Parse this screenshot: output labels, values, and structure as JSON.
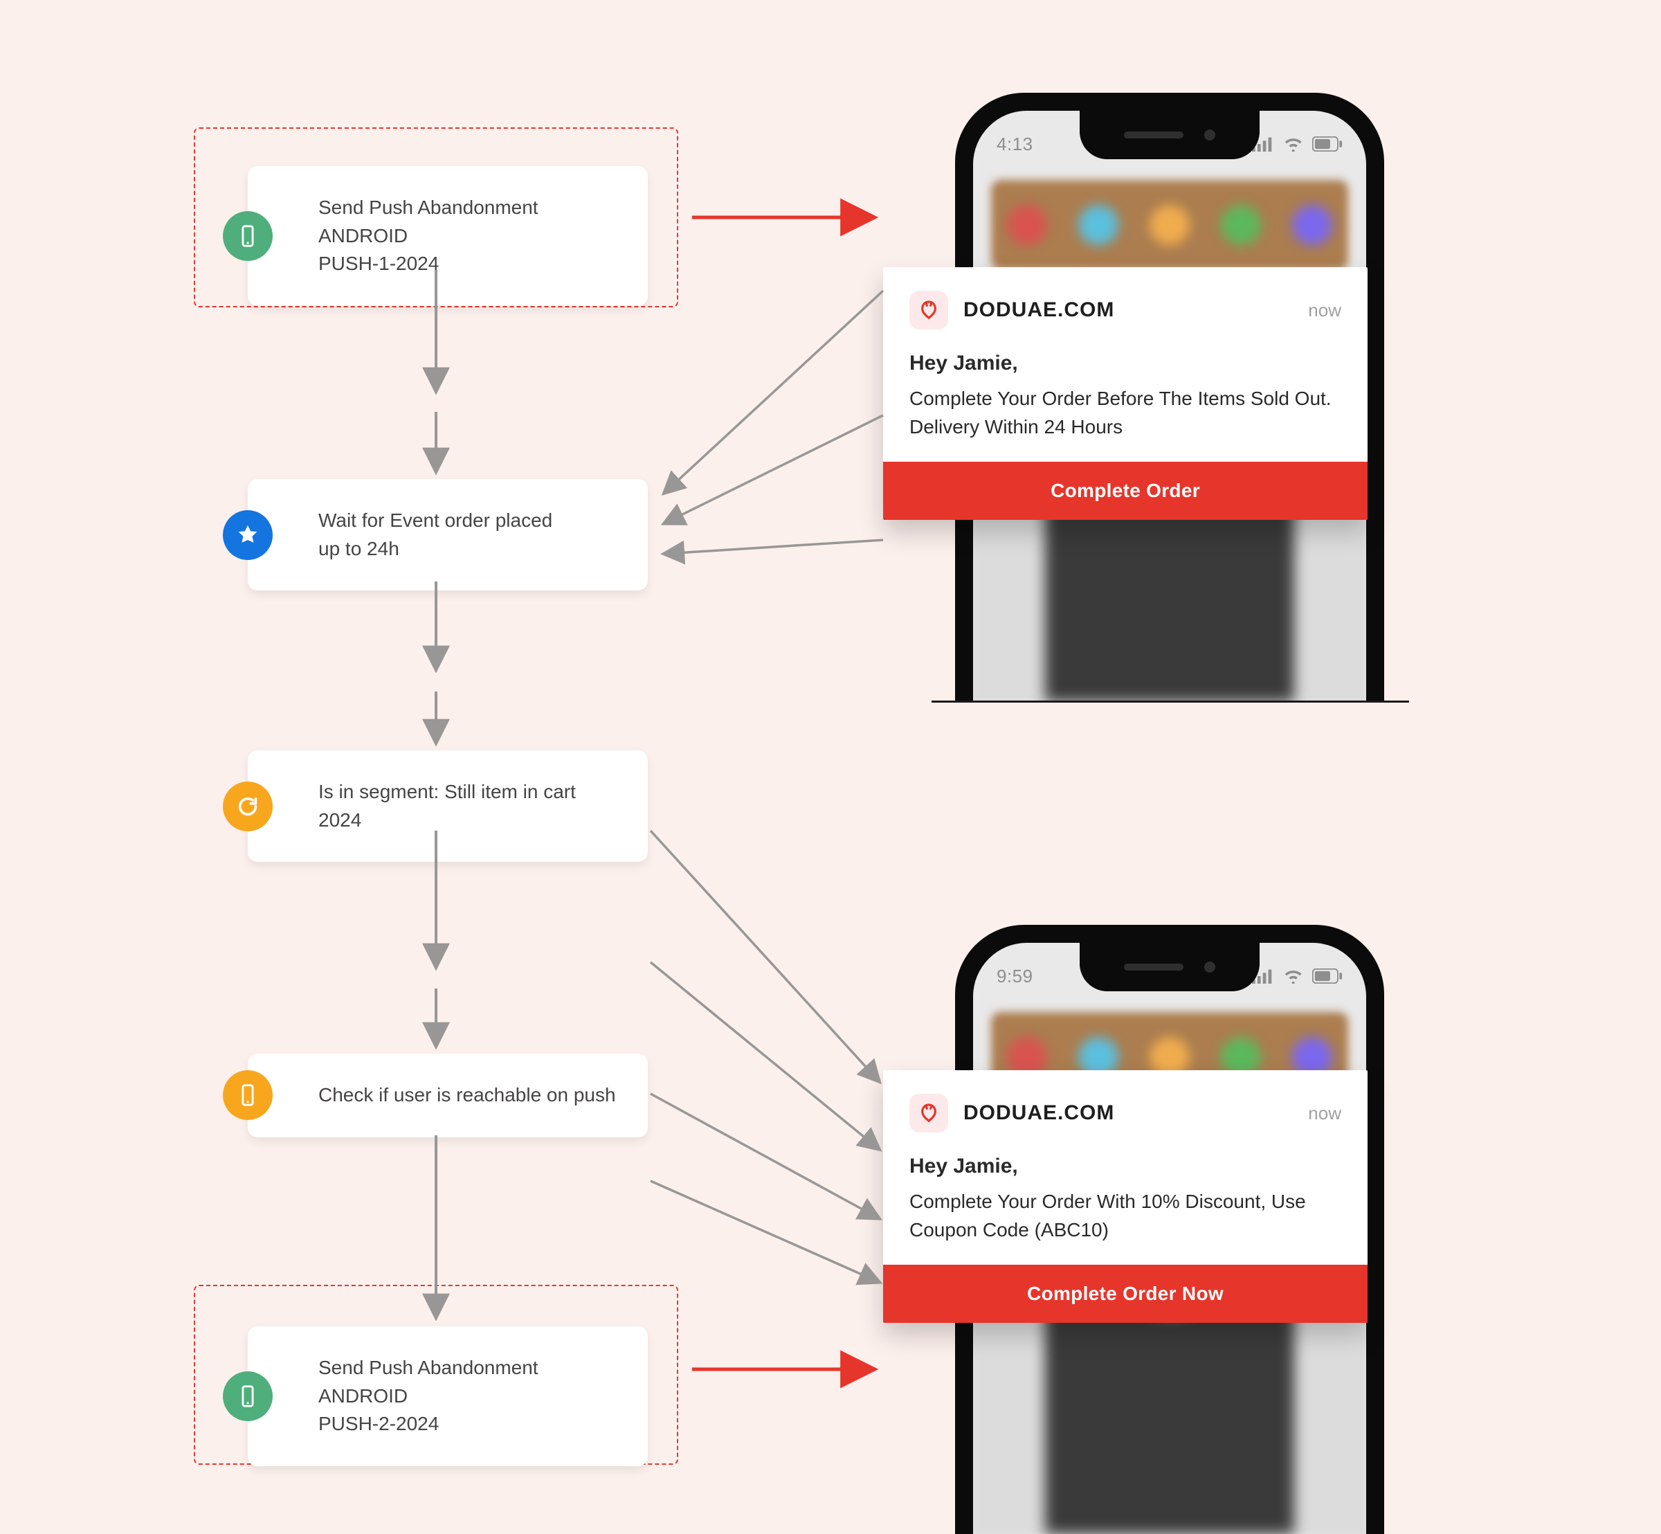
{
  "flow": {
    "nodes": [
      {
        "id": "n1",
        "icon": "phone",
        "badge": "green",
        "line1": "Send Push Abandonment ANDROID",
        "line2": "PUSH-1-2024"
      },
      {
        "id": "n2",
        "icon": "star",
        "badge": "blue",
        "line1": "Wait for Event order placed",
        "line2": "up to 24h"
      },
      {
        "id": "n3",
        "icon": "refresh",
        "badge": "orange",
        "line1": "Is in segment: Still item in cart 2024",
        "line2": ""
      },
      {
        "id": "n4",
        "icon": "phone",
        "badge": "orange",
        "line1": "Check if user is reachable on push",
        "line2": ""
      },
      {
        "id": "n5",
        "icon": "phone",
        "badge": "green",
        "line1": "Send Push Abandonment ANDROID",
        "line2": "PUSH-2-2024"
      }
    ]
  },
  "notifications": [
    {
      "clock": "4:13",
      "site": "DODUAE.COM",
      "when": "now",
      "greeting": "Hey Jamie,",
      "message": "Complete Your Order Before The Items Sold Out. Delivery Within 24 Hours",
      "cta": "Complete Order"
    },
    {
      "clock": "9:59",
      "site": "DODUAE.COM",
      "when": "now",
      "greeting": "Hey Jamie,",
      "message": "Complete Your Order With 10% Discount, Use Coupon Code (ABC10)",
      "cta": "Complete Order Now"
    }
  ],
  "colors": {
    "accent_red": "#e6352b",
    "badge_green": "#4eaf7c",
    "badge_blue": "#1474e0",
    "badge_orange": "#f8a61e"
  }
}
